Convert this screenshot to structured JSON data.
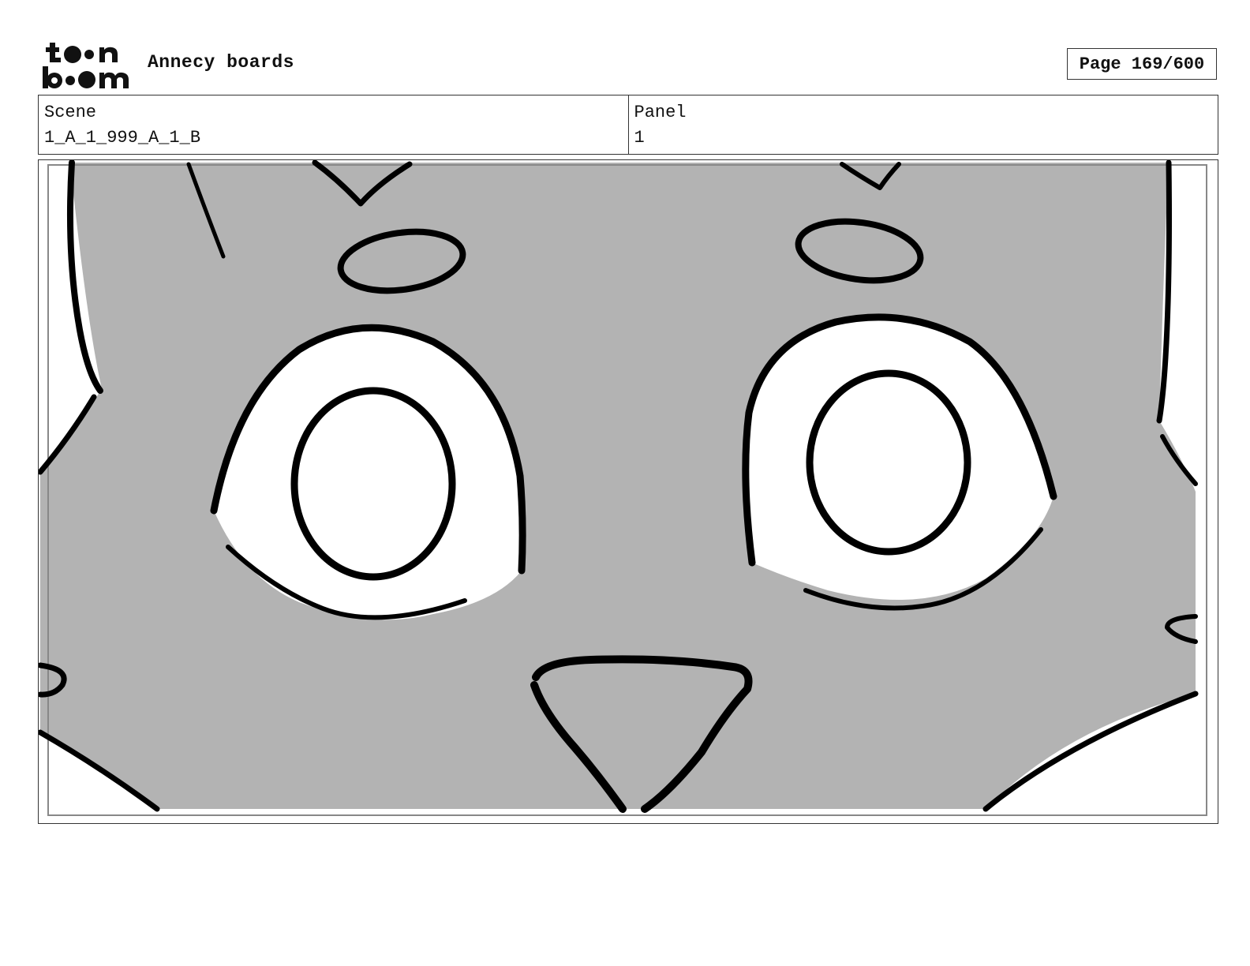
{
  "header": {
    "logo_alt": "toon boom",
    "project_title": "Annecy boards",
    "page_label": "Page 169/600"
  },
  "info": {
    "scene_label": "Scene",
    "scene_value": "1_A_1_999_A_1_B",
    "panel_label": "Panel",
    "panel_value": "1"
  },
  "drawing": {
    "description_icon": "cat-face-closeup-drawing",
    "fill_color": "#b3b3b3",
    "line_color": "#000000",
    "background_color": "#ffffff"
  }
}
